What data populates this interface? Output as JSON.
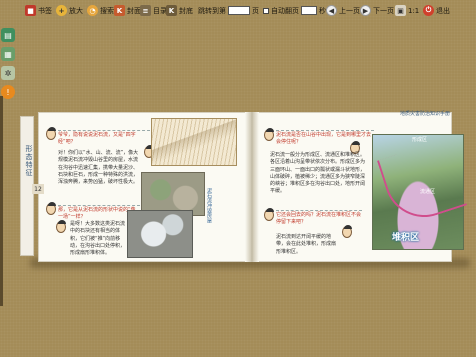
{
  "toolbar": {
    "bookmark": "书签",
    "zoom": "放大",
    "search": "搜索",
    "cover": "封面",
    "toc": "目录",
    "back_cover": "封底",
    "goto_prefix": "跳转到第",
    "goto_suffix": "页",
    "autoplay": "自动翻页",
    "seconds": "秒",
    "prev": "上一页",
    "next": "下一页",
    "ratio": "1:1",
    "exit": "退出"
  },
  "book": {
    "tab_label": "形态特征",
    "page_left": "12",
    "page_right": "13",
    "right_header": "地质灾害防治知识手册",
    "left": {
      "bubble1": "爷爷，隐有说说泥石流，又是“四字经”吧？",
      "para1": "对！你们以“水、山、流、流”，像大规模泥石流冲毁山谷里的房屋，水流在沟谷中迅速汇集，携带大量泥沙、石块和巨石，形成一种特殊的洪流，浑浊奔腾，来势凶猛，破坏性极大。",
      "bubble2": "那，它是从泥石流的形状中说的“像一场”一样？",
      "para2": "是呀！大多数这类泥石流中的石块还有相当的体积，它们被“推”向前移动，在沟谷出口处停积，形成扇形堆积体。",
      "caption": "泥石流冲毁房屋"
    },
    "right": {
      "bubble1": "泥石流是否在山谷中出现，它是到哪里才去会停住呢？",
      "para1": "泥石流一般分为形成区、流通区和堆积区。各区沿着山沟呈带状依次分布。形成区多为三面环山、一面出口的瓢状或漏斗状地形，山体破碎，植被稀少；流通区多为狭窄陡深的峡谷；堆积区多在沟谷出口处，地形开阔平缓。",
      "bubble2": "它还会回去的吗？泥石流在堆积区不会停留下来吧？",
      "para2": "泥石流到达开阔平缓的地带，会在此处堆积，形成扇形堆积区。",
      "map_label_top": "形成区",
      "map_label_mid": "流通区",
      "map_label_bottom": "堆积区"
    }
  },
  "side": {
    "tools": [
      "bookmark-list",
      "thumbnail",
      "settings",
      "help"
    ]
  }
}
